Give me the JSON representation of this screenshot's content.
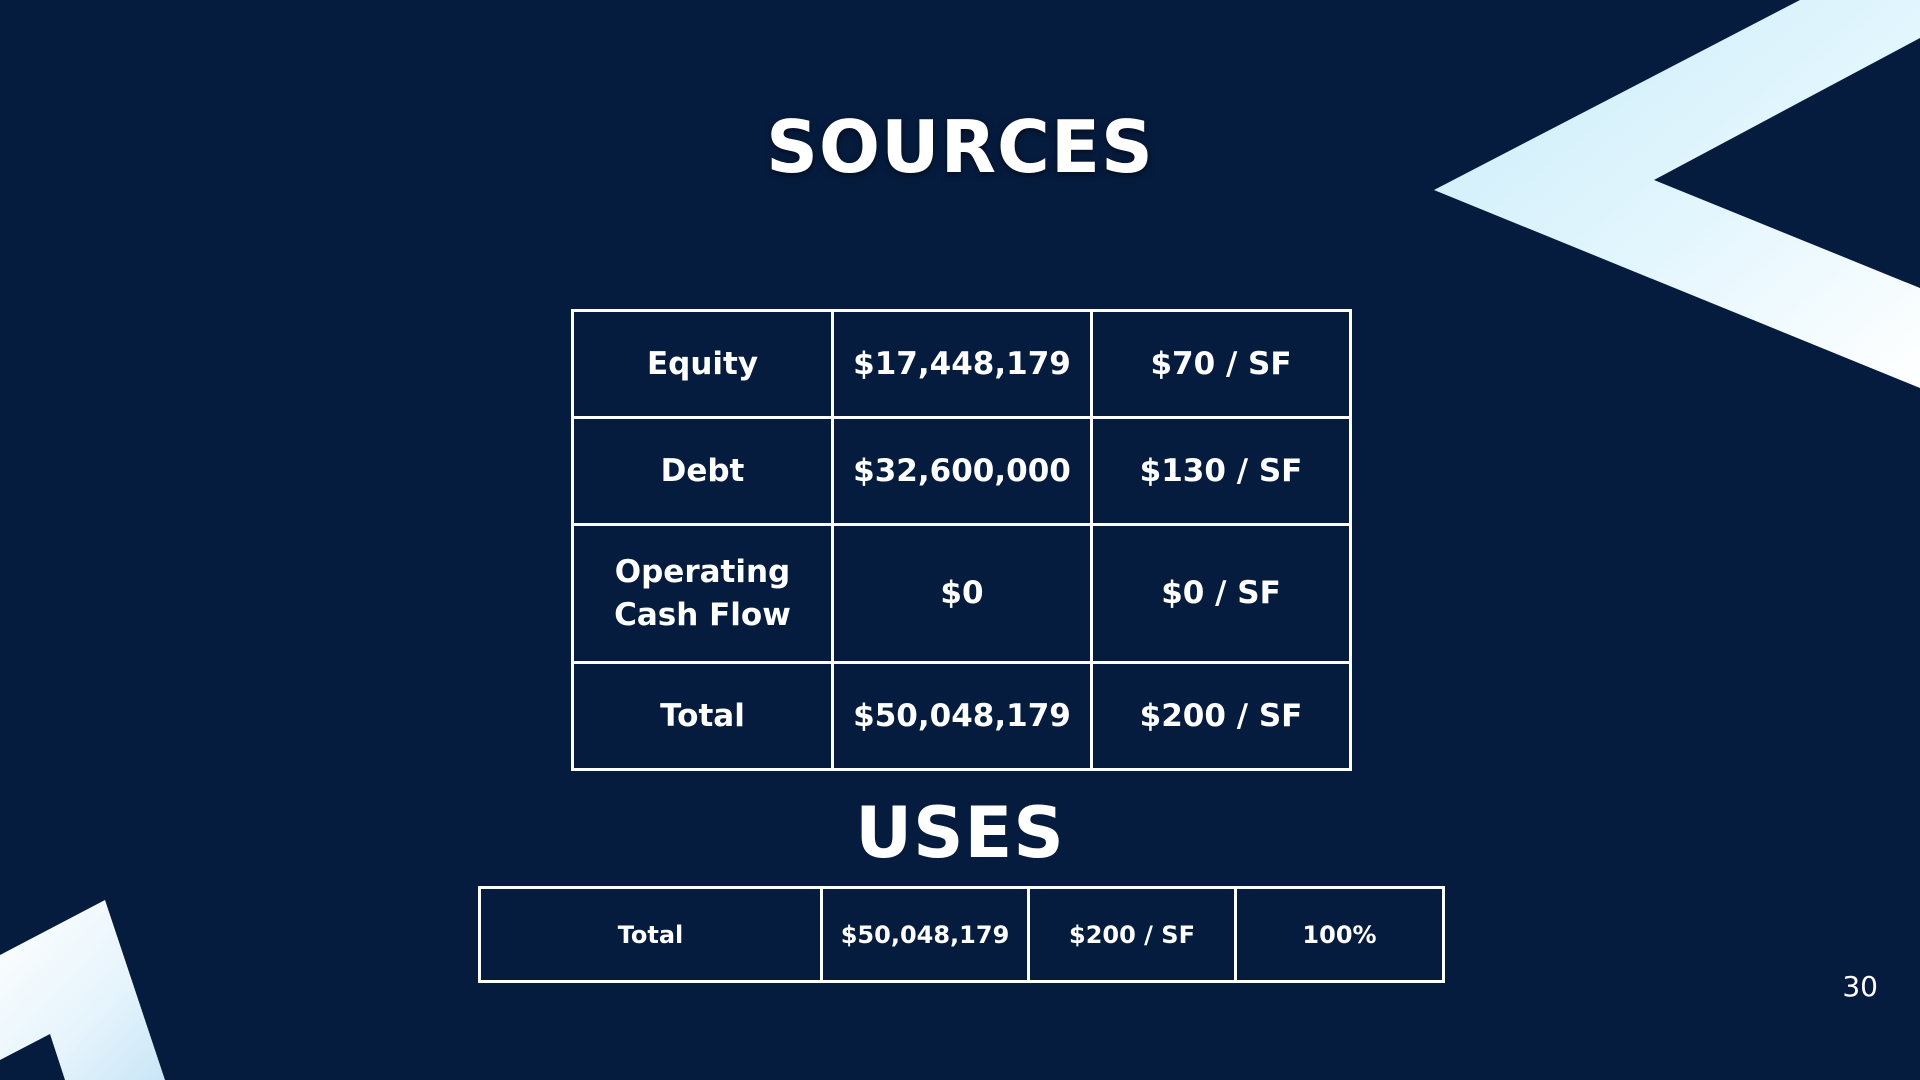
{
  "sources": {
    "title": "SOURCES",
    "rows": [
      {
        "label": "Equity",
        "amount": "$17,448,179",
        "per_sf": "$70 / SF"
      },
      {
        "label": "Debt",
        "amount": "$32,600,000",
        "per_sf": "$130 / SF"
      },
      {
        "label_line1": "Operating",
        "label_line2": "Cash Flow",
        "amount": "$0",
        "per_sf": "$0 / SF"
      },
      {
        "label": "Total",
        "amount": "$50,048,179",
        "per_sf": "$200 / SF"
      }
    ]
  },
  "uses": {
    "title": "USES",
    "rows": [
      {
        "label": "Total",
        "amount": "$50,048,179",
        "per_sf": "$200 / SF",
        "percent": "100%"
      }
    ]
  },
  "page_number": "30",
  "colors": {
    "background": "#061c3f",
    "text": "#ffffff",
    "accent_light": "#d2f0fb"
  }
}
